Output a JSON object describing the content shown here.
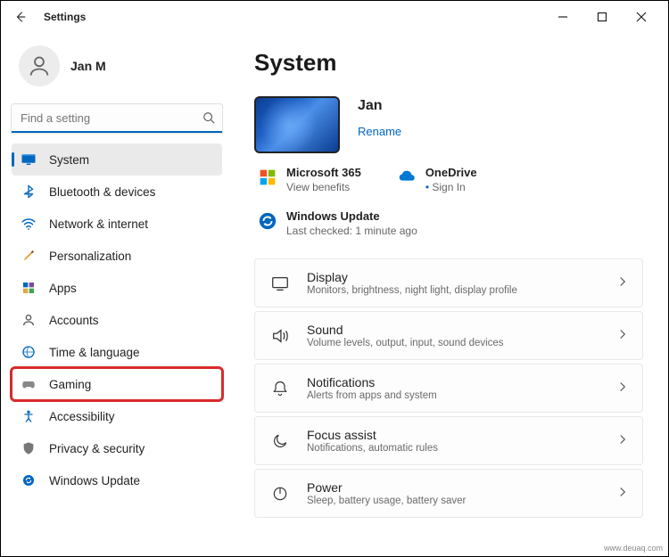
{
  "titlebar": {
    "app_title": "Settings"
  },
  "user": {
    "name": "Jan M"
  },
  "search": {
    "placeholder": "Find a setting"
  },
  "nav": {
    "items": [
      {
        "id": "system",
        "label": "System"
      },
      {
        "id": "bluetooth",
        "label": "Bluetooth & devices"
      },
      {
        "id": "network",
        "label": "Network & internet"
      },
      {
        "id": "personalization",
        "label": "Personalization"
      },
      {
        "id": "apps",
        "label": "Apps"
      },
      {
        "id": "accounts",
        "label": "Accounts"
      },
      {
        "id": "time",
        "label": "Time & language"
      },
      {
        "id": "gaming",
        "label": "Gaming"
      },
      {
        "id": "accessibility",
        "label": "Accessibility"
      },
      {
        "id": "privacy",
        "label": "Privacy & security"
      },
      {
        "id": "update",
        "label": "Windows Update"
      }
    ]
  },
  "page": {
    "title": "System"
  },
  "device": {
    "name": "Jan",
    "rename": "Rename"
  },
  "cloud": {
    "m365": {
      "title": "Microsoft 365",
      "sub": "View benefits"
    },
    "onedrive": {
      "title": "OneDrive",
      "sub": "Sign In",
      "bullet": "•"
    },
    "update": {
      "title": "Windows Update",
      "sub": "Last checked: 1 minute ago"
    }
  },
  "cards": [
    {
      "id": "display",
      "title": "Display",
      "sub": "Monitors, brightness, night light, display profile"
    },
    {
      "id": "sound",
      "title": "Sound",
      "sub": "Volume levels, output, input, sound devices"
    },
    {
      "id": "notifications",
      "title": "Notifications",
      "sub": "Alerts from apps and system"
    },
    {
      "id": "focus",
      "title": "Focus assist",
      "sub": "Notifications, automatic rules"
    },
    {
      "id": "power",
      "title": "Power",
      "sub": "Sleep, battery usage, battery saver"
    }
  ],
  "watermark": "www.deuaq.com"
}
